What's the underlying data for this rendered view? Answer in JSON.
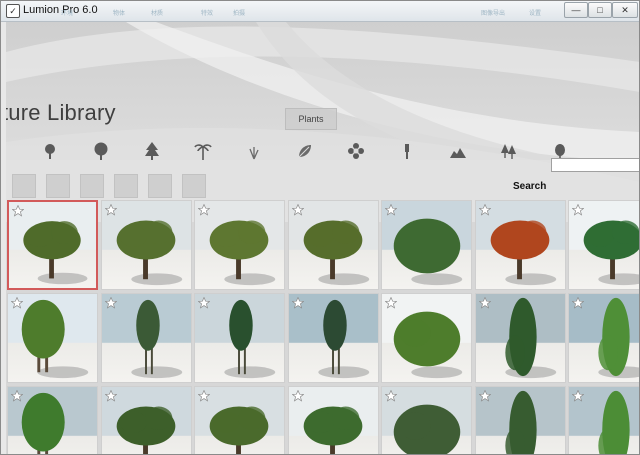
{
  "window": {
    "title": "Lumion Pro 6.0",
    "ghost_labels": [
      "环境",
      "物体",
      "材质",
      "特效",
      "拍摄",
      "图像导出",
      "设置"
    ],
    "controls": {
      "minimize": "—",
      "maximize": "□",
      "close": "✕"
    }
  },
  "library": {
    "heading": "ture Library",
    "active_tab": "Plants",
    "categories": [
      {
        "icon": "small-tree-icon"
      },
      {
        "icon": "round-tree-icon"
      },
      {
        "icon": "conifer-icon"
      },
      {
        "icon": "palm-icon"
      },
      {
        "icon": "grass-icon"
      },
      {
        "icon": "leaf-icon"
      },
      {
        "icon": "flower-icon"
      },
      {
        "icon": "figure-icon"
      },
      {
        "icon": "rock-icon"
      },
      {
        "icon": "forest-icon"
      },
      {
        "icon": "bush-icon"
      }
    ],
    "subcategory_count": 6,
    "search": {
      "label": "Search",
      "value": "",
      "placeholder": ""
    }
  },
  "thumbnails": [
    {
      "kind": "oak",
      "foliage": "#4f6b2a",
      "sky": "#e9eef0",
      "selected": true
    },
    {
      "kind": "oak",
      "foliage": "#56702f",
      "sky": "#dde3e5"
    },
    {
      "kind": "oak",
      "foliage": "#5e7731",
      "sky": "#e4e7e8"
    },
    {
      "kind": "oak",
      "foliage": "#566d2c",
      "sky": "#e2e5e6"
    },
    {
      "kind": "shrub",
      "foliage": "#3e6a32",
      "sky": "#c9d6dd"
    },
    {
      "kind": "autumn",
      "foliage": "#b0461e",
      "sky": "#d4dde2"
    },
    {
      "kind": "oak",
      "foliage": "#2f6d34",
      "sky": "#eef2f3"
    },
    {
      "kind": "tall",
      "foliage": "#4e7c2c",
      "sky": "#dfe8ee"
    },
    {
      "kind": "thin",
      "foliage": "#3b5a36",
      "sky": "#b9cbd3"
    },
    {
      "kind": "thin",
      "foliage": "#29502e",
      "sky": "#cbd6db"
    },
    {
      "kind": "thin",
      "foliage": "#2c4a33",
      "sky": "#a9bfc9"
    },
    {
      "kind": "shrub",
      "foliage": "#4e7d2c",
      "sky": "#f1f3f3"
    },
    {
      "kind": "column",
      "foliage": "#2f5a2c",
      "sky": "#aebec5"
    },
    {
      "kind": "column",
      "foliage": "#4f8f37",
      "sky": "#a6bcc7"
    },
    {
      "kind": "tall",
      "foliage": "#3f7b2d",
      "sky": "#b9c8cf"
    },
    {
      "kind": "oak",
      "foliage": "#3d5f2a",
      "sky": "#cfd9de"
    },
    {
      "kind": "oak",
      "foliage": "#4a6a2c",
      "sky": "#d8dfe2"
    },
    {
      "kind": "oak",
      "foliage": "#3d6b2e",
      "sky": "#eaeeef"
    },
    {
      "kind": "shrub",
      "foliage": "#3f5d35",
      "sky": "#d5dde0"
    },
    {
      "kind": "column",
      "foliage": "#375c30",
      "sky": "#b6c4ca"
    },
    {
      "kind": "column",
      "foliage": "#4c8d36",
      "sky": "#b3c4cc"
    }
  ],
  "colors": {
    "accent_selected": "#d25a5a"
  }
}
